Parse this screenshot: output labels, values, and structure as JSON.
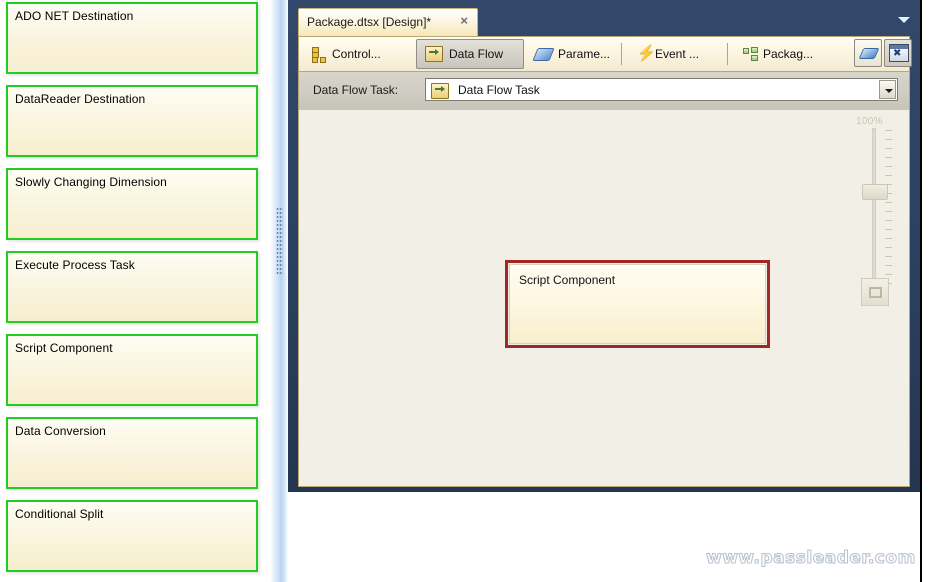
{
  "toolbox": {
    "items": [
      {
        "label": "ADO NET Destination"
      },
      {
        "label": "DataReader Destination"
      },
      {
        "label": "Slowly Changing Dimension"
      },
      {
        "label": "Execute Process Task"
      },
      {
        "label": "Script Component"
      },
      {
        "label": "Data Conversion"
      },
      {
        "label": "Conditional Split"
      }
    ],
    "highlight_color": "#22cc22",
    "fill_color": "#faf4de"
  },
  "document_tab": {
    "title": "Package.dtsx [Design]*",
    "close_label": "×"
  },
  "designer_tabs": [
    {
      "label": "Control...",
      "icon": "control-flow-icon",
      "active": false
    },
    {
      "label": "Data Flow",
      "icon": "data-flow-icon",
      "active": true
    },
    {
      "label": "Parame...",
      "icon": "parameters-icon",
      "active": false
    },
    {
      "label": "Event ...",
      "icon": "event-handlers-icon",
      "active": false
    },
    {
      "label": "Packag...",
      "icon": "package-explorer-icon",
      "active": false
    }
  ],
  "toolbar_buttons": [
    {
      "name": "annotation-button",
      "icon": "annotation-icon"
    },
    {
      "name": "execute-button",
      "icon": "execute-window-icon"
    }
  ],
  "task_selector": {
    "label": "Data Flow Task:",
    "value": "Data Flow Task",
    "icon": "data-flow-task-icon",
    "options": [
      "Data Flow Task"
    ]
  },
  "canvas": {
    "background_color": "#f2f0e6",
    "nodes": [
      {
        "label": "Script Component",
        "selected": true,
        "border_color": "#a02828"
      }
    ]
  },
  "zoom_control": {
    "percent_label": "100%",
    "value": 100,
    "fit_button_icon": "fit-to-window-icon"
  },
  "watermark": {
    "text": "www.passleader.com"
  }
}
